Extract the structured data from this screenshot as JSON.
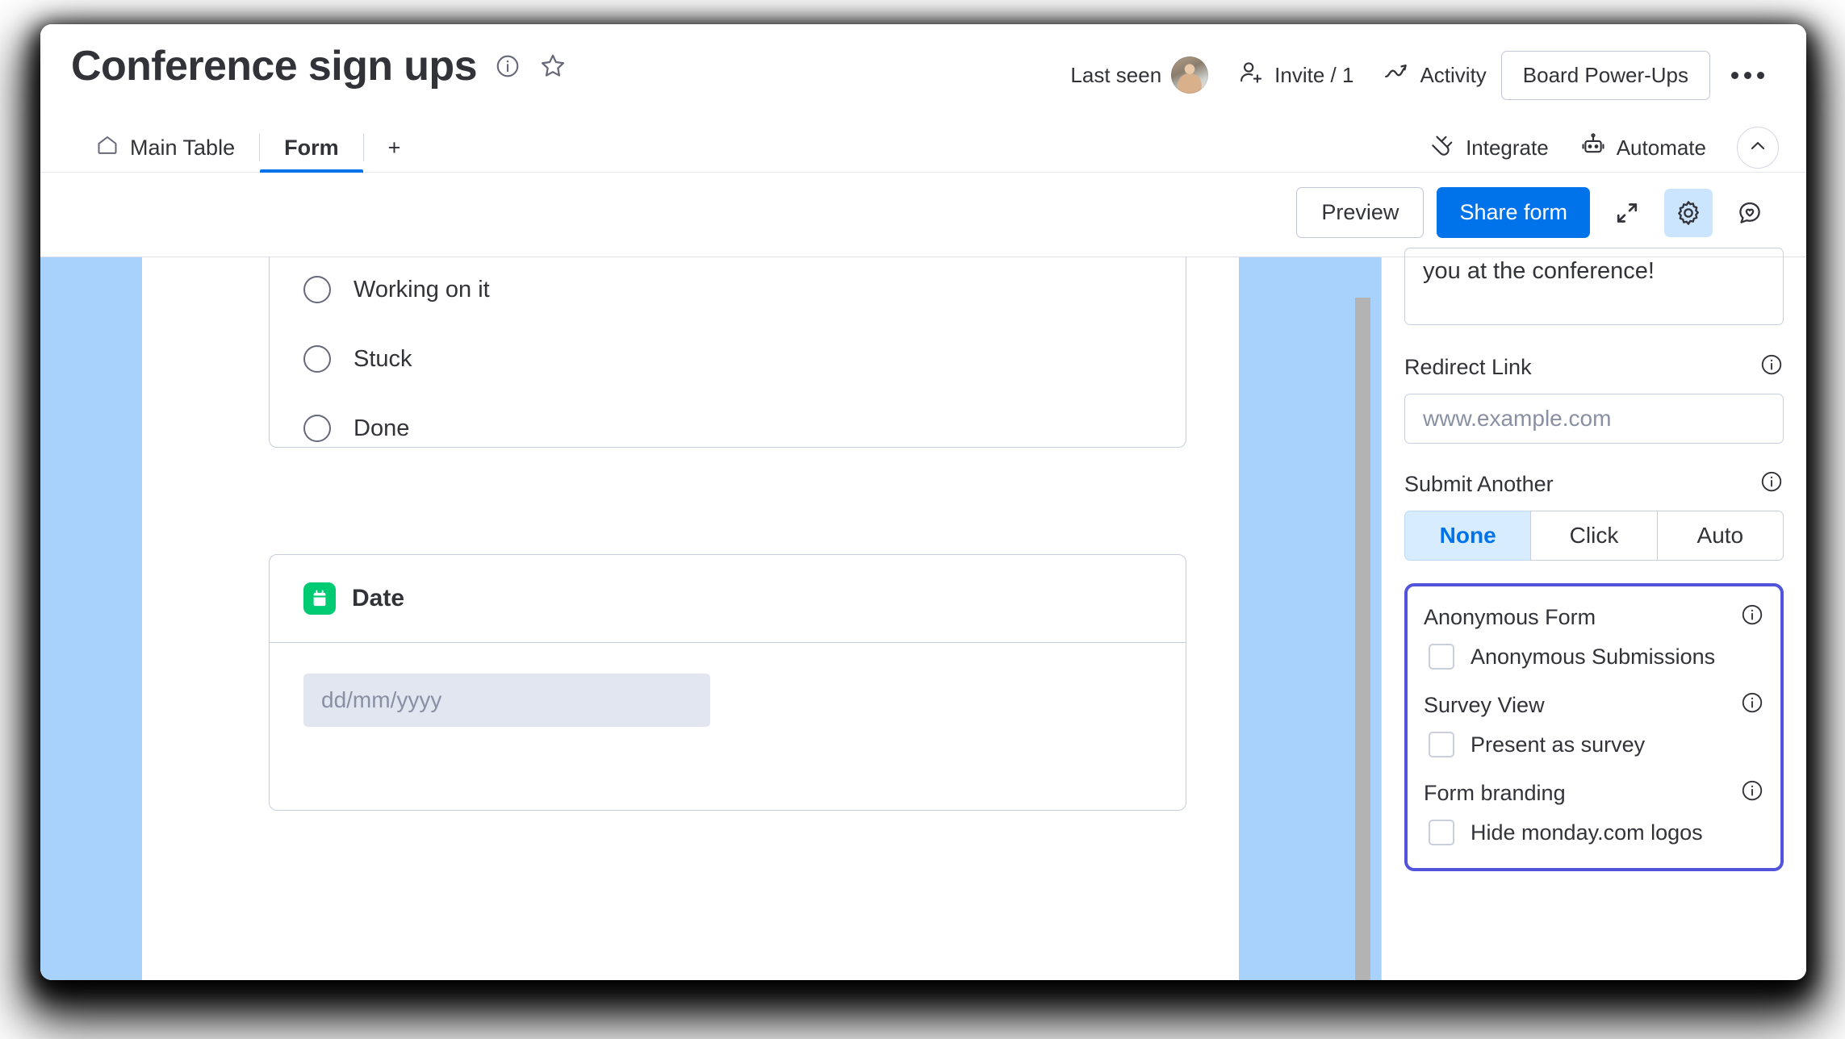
{
  "header": {
    "board_title": "Conference sign ups",
    "info_icon": "info-circle-icon",
    "star_icon": "star-outline-icon",
    "last_seen_label": "Last seen",
    "invite_label": "Invite / 1",
    "activity_label": "Activity",
    "power_ups_label": "Board Power-Ups",
    "more_icon": "more-options-icon"
  },
  "tabs": {
    "items": [
      {
        "label": "Main Table",
        "icon": "home-icon",
        "active": false
      },
      {
        "label": "Form",
        "icon": "",
        "active": true
      }
    ],
    "add_label": "+",
    "integrate_label": "Integrate",
    "automate_label": "Automate",
    "collapse_icon": "chevron-up-icon"
  },
  "toolbar": {
    "preview_label": "Preview",
    "share_label": "Share form",
    "expand_icon": "expand-icon",
    "settings_icon": "gear-icon",
    "feedback_icon": "heart-bubble-icon"
  },
  "form": {
    "status_card": {
      "options": [
        "Working on it",
        "Stuck",
        "Done"
      ]
    },
    "date_card": {
      "title": "Date",
      "icon": "calendar-icon",
      "icon_color": "#00ca72",
      "placeholder": "dd/mm/yyyy"
    }
  },
  "settings": {
    "message_text": "you at the conference!",
    "redirect_label": "Redirect Link",
    "redirect_placeholder": "www.example.com",
    "submit_another_label": "Submit Another",
    "submit_another_options": [
      "None",
      "Click",
      "Auto"
    ],
    "submit_another_selected": "None",
    "highlight": {
      "border_color": "#5254db",
      "groups": [
        {
          "label": "Anonymous Form",
          "checkbox_label": "Anonymous Submissions",
          "checked": false
        },
        {
          "label": "Survey View",
          "checkbox_label": "Present as survey",
          "checked": false
        },
        {
          "label": "Form branding",
          "checkbox_label": "Hide monday.com logos",
          "checked": false
        }
      ]
    }
  },
  "colors": {
    "accent_blue": "#0073ea",
    "form_bg_blue": "#a8d2fb",
    "highlight_purple": "#5254db",
    "date_green": "#00ca72"
  }
}
